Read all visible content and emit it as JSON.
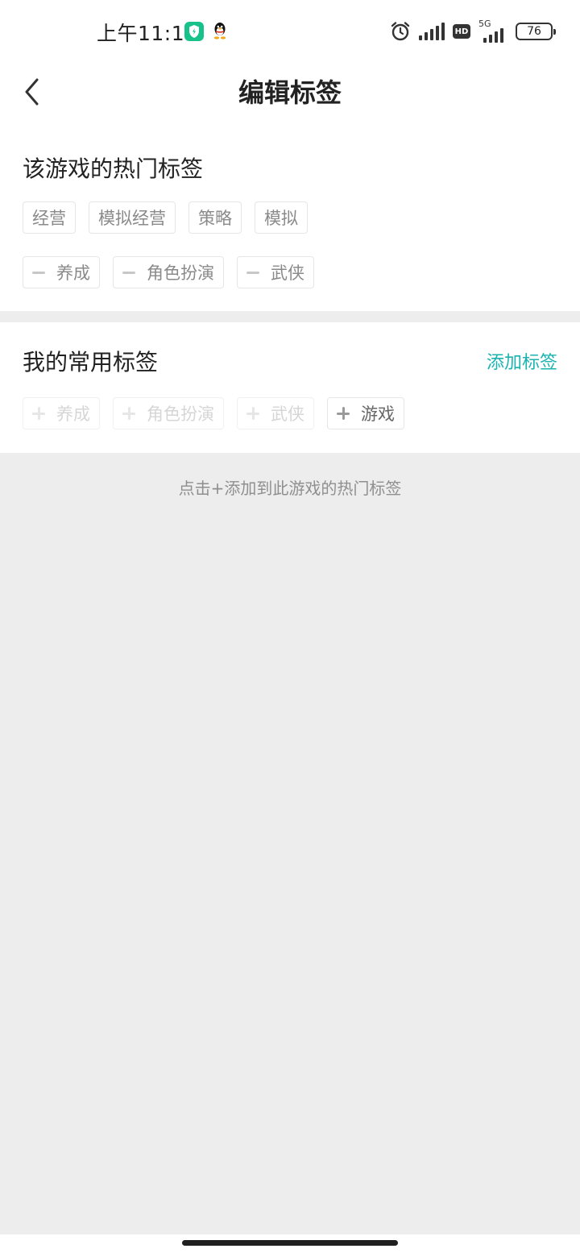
{
  "status_bar": {
    "time": "上午11:14",
    "icons": [
      "shield-icon",
      "qq-icon",
      "alarm-icon",
      "signal-icon",
      "hd-badge",
      "5g-signal-icon",
      "battery-icon"
    ],
    "hd_label": "HD",
    "network_label": "5G",
    "battery": "76",
    "shield_color": "#16c28a"
  },
  "header": {
    "title": "编辑标签",
    "back_icon": "chevron-left-icon"
  },
  "hot_tags": {
    "title": "该游戏的热门标签",
    "tags": [
      "经营",
      "模拟经营",
      "策略",
      "模拟"
    ],
    "editable_tags": [
      "养成",
      "角色扮演",
      "武侠"
    ]
  },
  "common_tags": {
    "title": "我的常用标签",
    "add_link": "添加标签",
    "add_link_color": "#1ab3b0",
    "tags": [
      {
        "label": "养成",
        "state": "disabled"
      },
      {
        "label": "角色扮演",
        "state": "disabled"
      },
      {
        "label": "武侠",
        "state": "disabled"
      },
      {
        "label": "游戏",
        "state": "active"
      }
    ]
  },
  "hint": "点击+添加到此游戏的热门标签"
}
